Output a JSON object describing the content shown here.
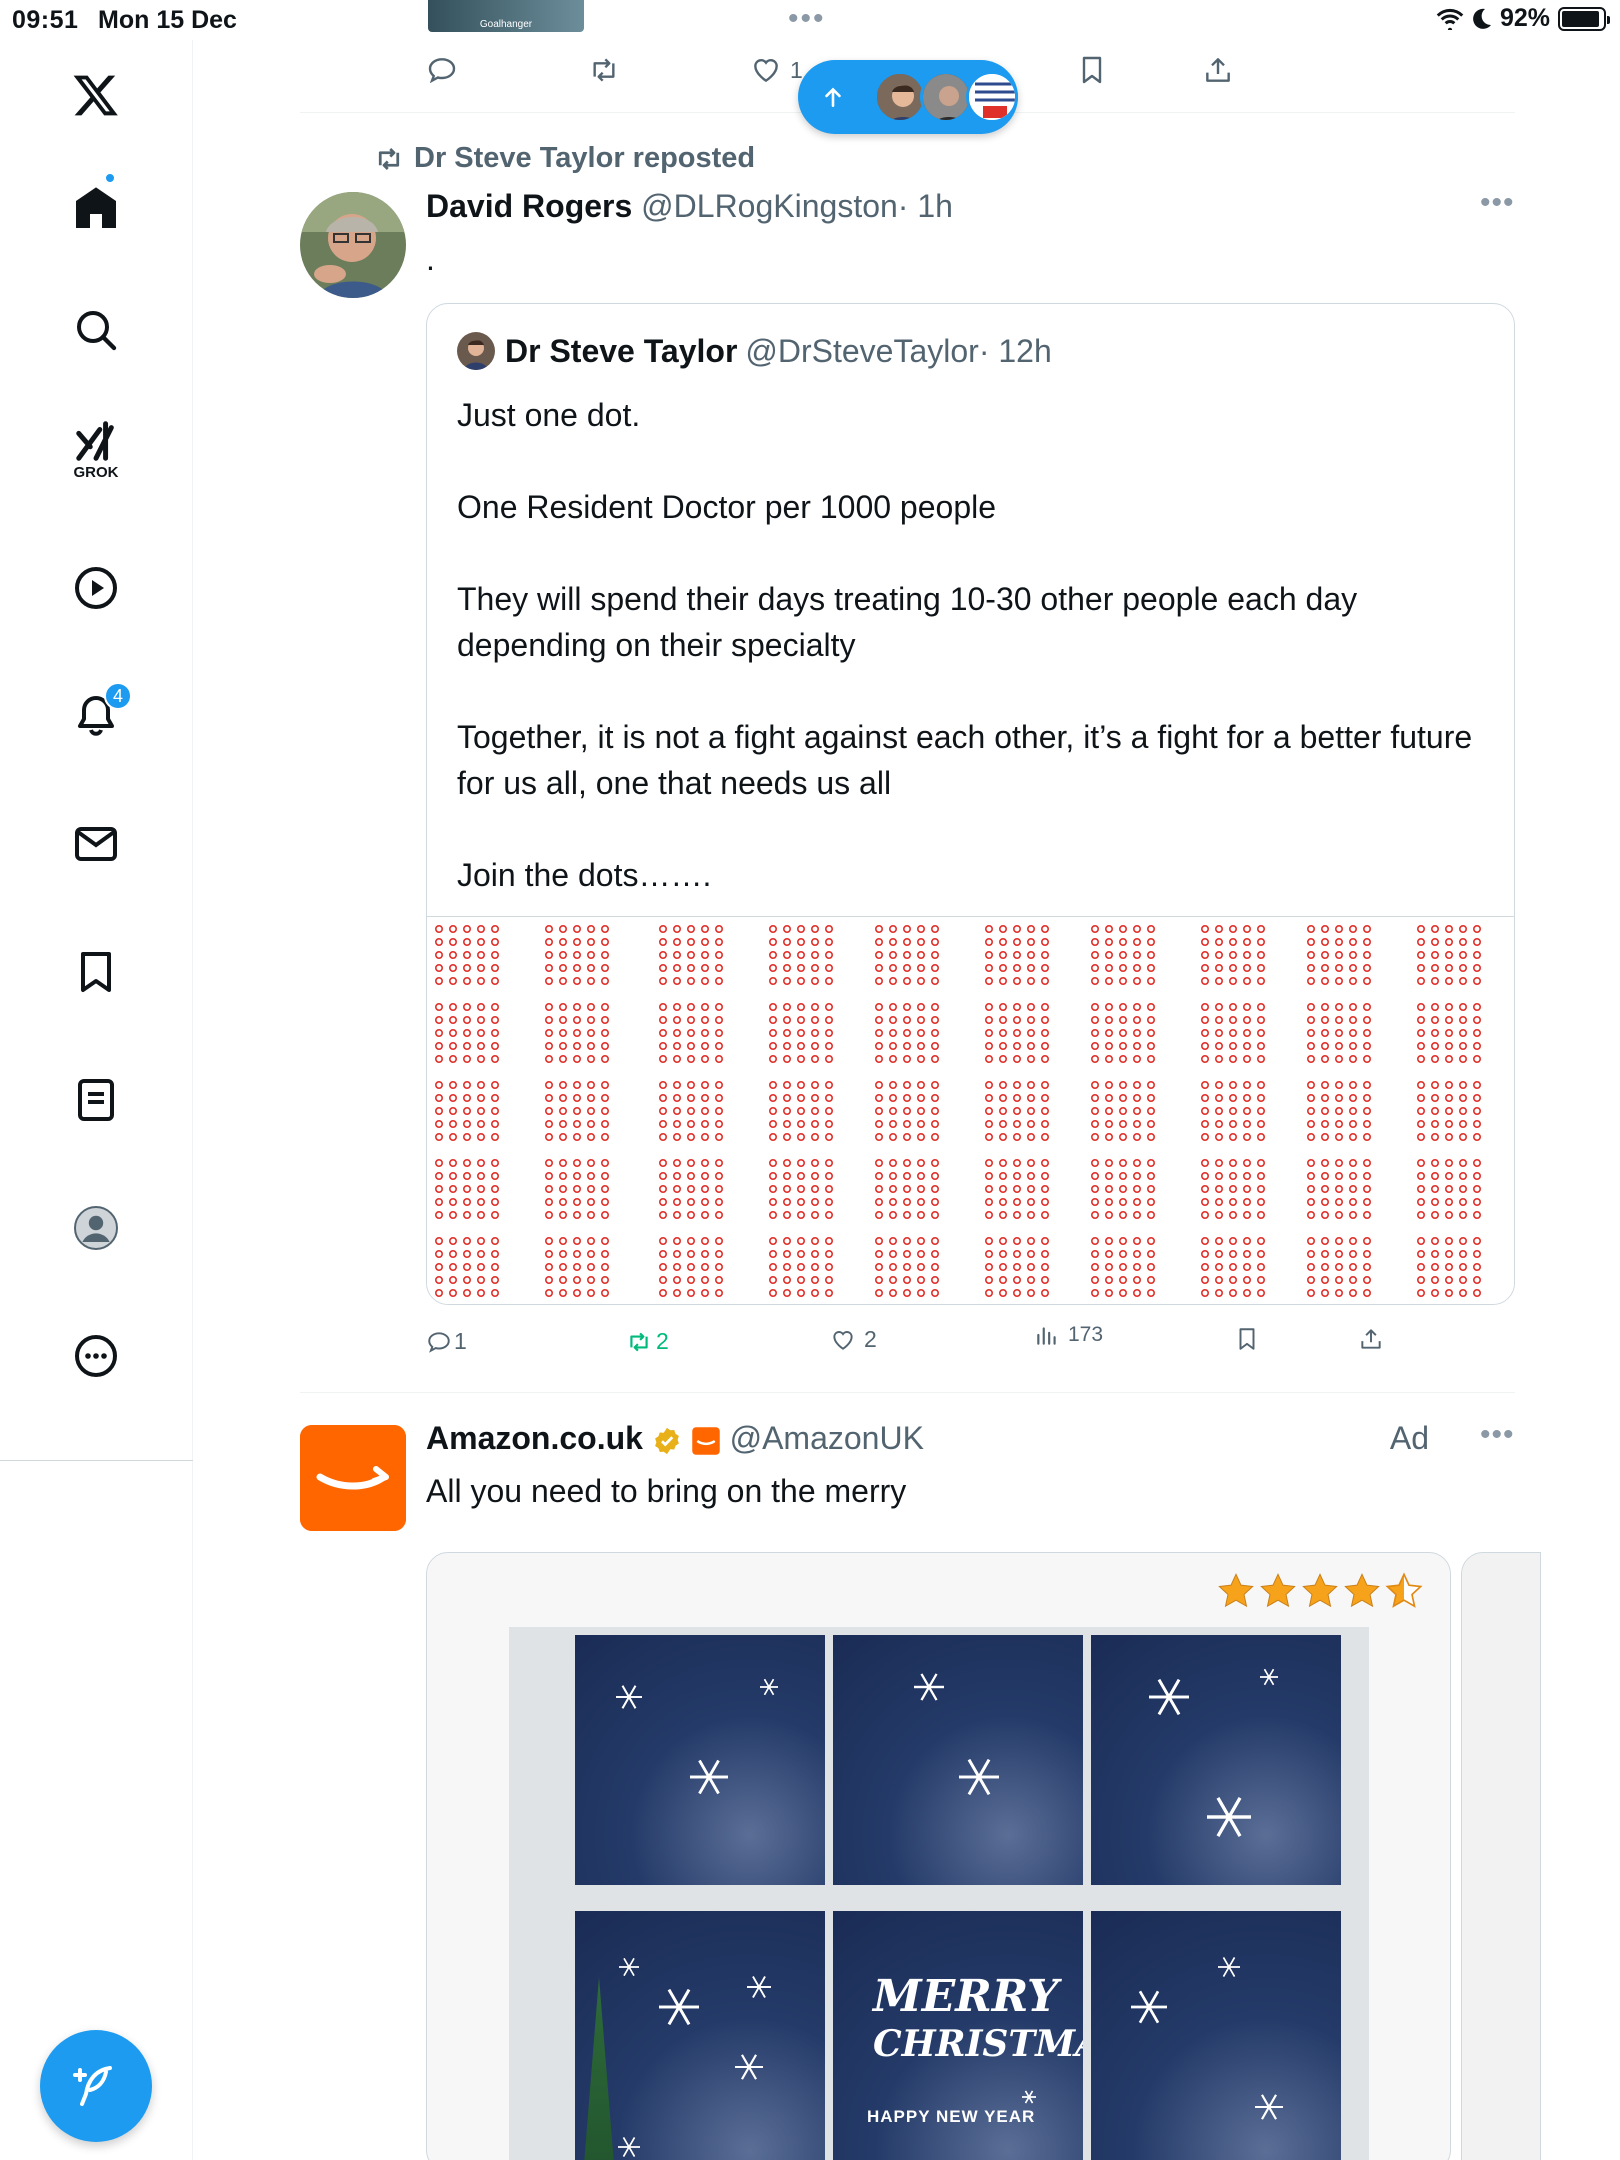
{
  "status_bar": {
    "time": "09:51",
    "date": "Mon 15 Dec",
    "battery": "92%"
  },
  "sidebar": {
    "items": [
      {
        "name": "x-logo"
      },
      {
        "name": "home-icon",
        "has_dot": true
      },
      {
        "name": "search-icon"
      },
      {
        "name": "grok-icon",
        "label": "GROK"
      },
      {
        "name": "video-icon"
      },
      {
        "name": "notifications-icon",
        "badge": "4"
      },
      {
        "name": "messages-icon"
      },
      {
        "name": "bookmarks-icon"
      },
      {
        "name": "lists-icon"
      },
      {
        "name": "profile-icon"
      },
      {
        "name": "more-icon"
      }
    ],
    "compose_icon": "compose-icon"
  },
  "top_thumb": {
    "label": "Goalhanger"
  },
  "prev_post_actions": {
    "like_count": "1"
  },
  "new_posts_pill": {
    "icon": "arrow-up-icon"
  },
  "repost": {
    "label": "Dr Steve Taylor reposted",
    "author_name": "David Rogers",
    "author_handle": "@DLRogKingston",
    "time": "· 1h",
    "text": "."
  },
  "quote": {
    "author_name": "Dr Steve Taylor",
    "author_handle": "@DrSteveTaylor",
    "time": "· 12h",
    "text": "Just one dot.\n\nOne Resident Doctor per 1000 people\n\nThey will spend their days treating 10-30 other people each day depending on their specialty\n\nTogether, it is not a fight against each other, it’s a fight for a better future for us all, one that needs us all\n\nJoin the dots……."
  },
  "post_actions": {
    "replies": "1",
    "reposts": "2",
    "likes": "2",
    "views": "173",
    "colors": {
      "repost_active": "#00ba7c",
      "muted": "#536471"
    }
  },
  "ad": {
    "author_name": "Amazon.co.uk",
    "author_handle": "@AmazonUK",
    "ad_label": "Ad",
    "text": "All you need to bring on the merry",
    "rating": 4.5,
    "image_text_1": "MERRY",
    "image_text_2": "CHRISTMAS",
    "image_text_3": "HAPPY NEW YEAR"
  },
  "colors": {
    "accent": "#1d9bf0",
    "text": "#0f1419",
    "muted": "#536471",
    "dot_red": "#e0302a",
    "amazon_orange": "#ff6600",
    "star": "#f7a21b"
  }
}
